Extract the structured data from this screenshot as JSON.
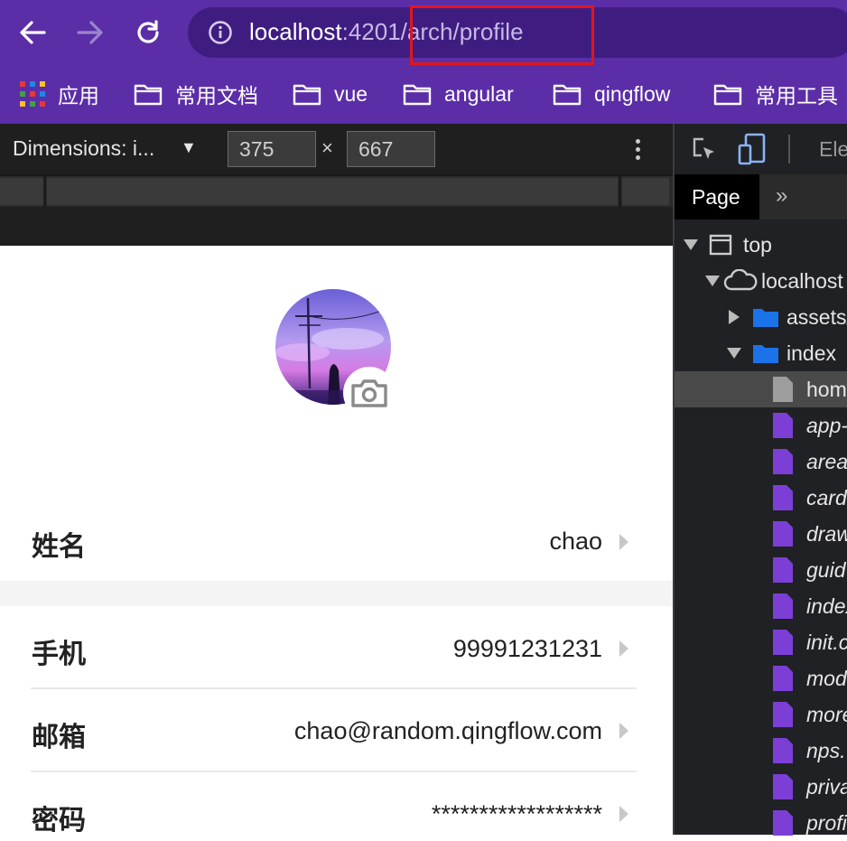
{
  "browser": {
    "url_host": "localhost",
    "url_port_path_pre": ":420",
    "url_tail": "1/arch/profile",
    "bookmarks": [
      "应用",
      "常用文档",
      "vue",
      "angular",
      "qingflow",
      "常用工具"
    ]
  },
  "device_toolbar": {
    "dimensions_label": "Dimensions: i...",
    "width": "375",
    "height": "667",
    "times": "×"
  },
  "profile": {
    "rows": [
      {
        "label": "姓名",
        "value": "chao"
      },
      {
        "label": "手机",
        "value": "99991231231"
      },
      {
        "label": "邮箱",
        "value": "chao@random.qingflow.com"
      },
      {
        "label": "密码",
        "value": "******************"
      }
    ]
  },
  "devtools": {
    "top_label": "Ele",
    "page_tab": "Page",
    "more_tabs": "»",
    "tree": [
      {
        "label": "top"
      },
      {
        "label": "localhost"
      },
      {
        "label": "assets/"
      },
      {
        "label": "index"
      },
      {
        "label": "hom"
      },
      {
        "label": "app-"
      },
      {
        "label": "area"
      },
      {
        "label": "card"
      },
      {
        "label": "draw"
      },
      {
        "label": "guid"
      },
      {
        "label": "index"
      },
      {
        "label": "init.c"
      },
      {
        "label": "mod"
      },
      {
        "label": "more"
      },
      {
        "label": "nps."
      },
      {
        "label": "priva"
      },
      {
        "label": "profi"
      }
    ]
  }
}
